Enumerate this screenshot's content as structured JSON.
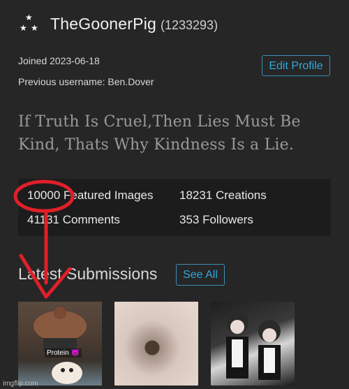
{
  "profile": {
    "username": "TheGoonerPig",
    "user_id": "(1233293)",
    "joined": "Joined 2023-06-18",
    "previous_username": "Previous username: Ben.Dover",
    "edit_label": "Edit Profile",
    "bio": "If Truth Is Cruel,Then Lies Must Be Kind, Thats Why Kindness Is a Lie."
  },
  "stats": {
    "featured": "10000 Featured Images",
    "creations": "18231 Creations",
    "comments": "41131 Comments",
    "followers": "353 Followers"
  },
  "submissions": {
    "title": "Latest Submissions",
    "see_all_label": "See All",
    "thumb1_caption": "Protein 😈"
  },
  "watermark": "imgflip.com",
  "colors": {
    "background": "#262626",
    "accent": "#2fa8e0",
    "annotation": "#e01f2a"
  }
}
